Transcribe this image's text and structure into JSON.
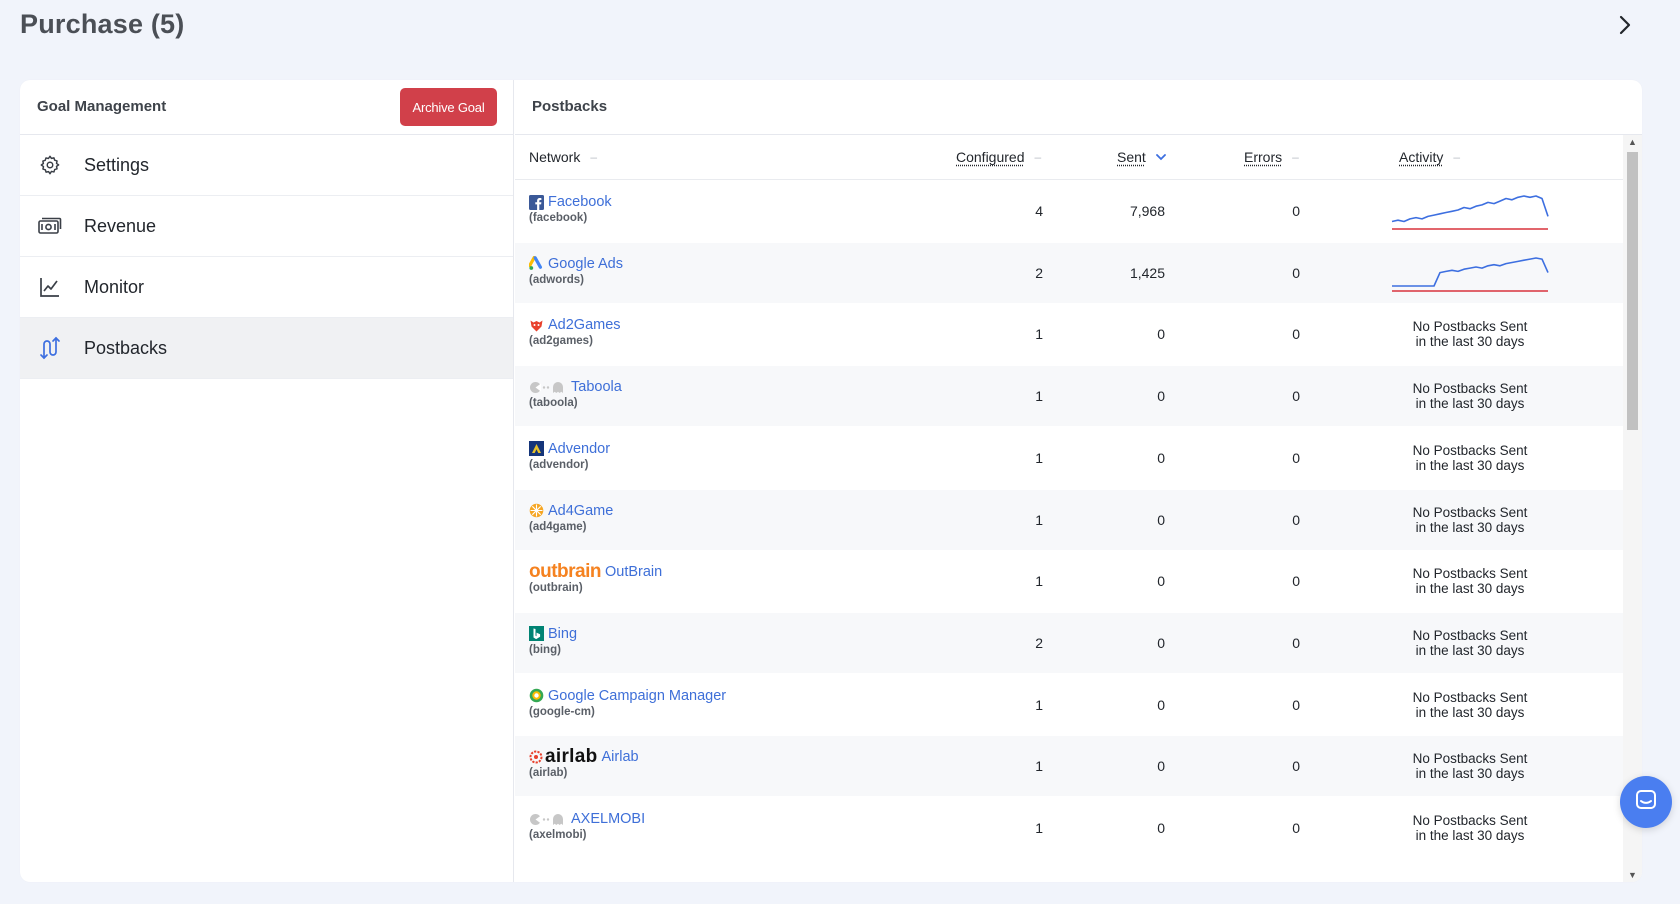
{
  "page": {
    "title": "Purchase (5)"
  },
  "left": {
    "title": "Goal Management",
    "archive_label": "Archive Goal",
    "nav": [
      {
        "label": "Settings",
        "icon": "gear-icon"
      },
      {
        "label": "Revenue",
        "icon": "money-icon"
      },
      {
        "label": "Monitor",
        "icon": "line-chart-icon"
      },
      {
        "label": "Postbacks",
        "icon": "postback-icon",
        "active": true
      }
    ]
  },
  "right": {
    "title": "Postbacks",
    "columns": {
      "network": "Network",
      "configured": "Configured",
      "sent": "Sent",
      "errors": "Errors",
      "activity": "Activity"
    },
    "no_activity_line1": "No Postbacks Sent",
    "no_activity_line2": "in the last 30 days",
    "rows": [
      {
        "name": "Facebook",
        "code": "(facebook)",
        "configured": "4",
        "sent": "7,968",
        "errors": "0",
        "icon": "facebook-icon",
        "activity": [
          2,
          3,
          2,
          4,
          5,
          4,
          6,
          7,
          8,
          9,
          10,
          11,
          13,
          12,
          14,
          15,
          17,
          16,
          18,
          20,
          19,
          21,
          22,
          21,
          22,
          20,
          6
        ]
      },
      {
        "name": "Google Ads",
        "code": "(adwords)",
        "configured": "2",
        "sent": "1,425",
        "errors": "0",
        "icon": "google-ads-icon",
        "activity": [
          0,
          0,
          0,
          0,
          0,
          0,
          0,
          0,
          12,
          13,
          14,
          13,
          15,
          16,
          17,
          16,
          18,
          19,
          18,
          20,
          21,
          22,
          23,
          24,
          25,
          24,
          12
        ]
      },
      {
        "name": "Ad2Games",
        "code": "(ad2games)",
        "configured": "1",
        "sent": "0",
        "errors": "0",
        "icon": "ad2games-icon"
      },
      {
        "name": "Taboola",
        "code": "(taboola)",
        "configured": "1",
        "sent": "0",
        "errors": "0",
        "icon": "taboola-icon"
      },
      {
        "name": "Advendor",
        "code": "(advendor)",
        "configured": "1",
        "sent": "0",
        "errors": "0",
        "icon": "advendor-icon"
      },
      {
        "name": "Ad4Game",
        "code": "(ad4game)",
        "configured": "1",
        "sent": "0",
        "errors": "0",
        "icon": "ad4game-icon"
      },
      {
        "name": "OutBrain",
        "code": "(outbrain)",
        "configured": "1",
        "sent": "0",
        "errors": "0",
        "icon": "outbrain-logo",
        "logo_text": "outbrain"
      },
      {
        "name": "Bing",
        "code": "(bing)",
        "configured": "2",
        "sent": "0",
        "errors": "0",
        "icon": "bing-icon"
      },
      {
        "name": "Google Campaign Manager",
        "code": "(google-cm)",
        "configured": "1",
        "sent": "0",
        "errors": "0",
        "icon": "google-cm-icon"
      },
      {
        "name": "Airlab",
        "code": "(airlab)",
        "configured": "1",
        "sent": "0",
        "errors": "0",
        "icon": "airlab-logo",
        "logo_text": "airlab"
      },
      {
        "name": "AXELMOBI",
        "code": "(axelmobi)",
        "configured": "1",
        "sent": "0",
        "errors": "0",
        "icon": "axelmobi-icon"
      }
    ]
  },
  "colors": {
    "accent": "#3e6fd8",
    "danger": "#d1404a",
    "spark_line": "#3d6fe0",
    "spark_error": "#d9323c",
    "chat": "#4a7ef0"
  }
}
